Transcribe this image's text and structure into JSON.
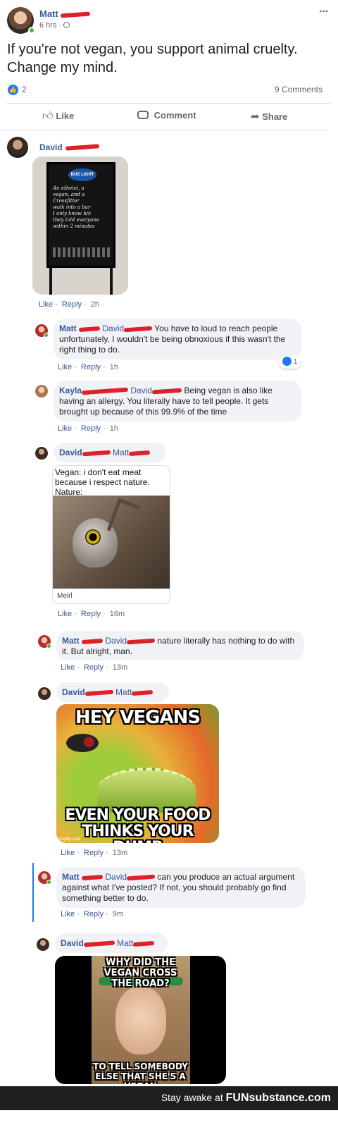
{
  "post": {
    "author": "Matt",
    "time": "6 hrs",
    "sep": "·",
    "text": "If you're not vegan, you support animal cruelty. Change my mind.",
    "like_count": "2",
    "comments_count": "9 Comments",
    "more": "···",
    "like_label": "Like",
    "comment_label": "Comment",
    "share_label": "Share"
  },
  "comments": [
    {
      "author": "David",
      "sign_lines": [
        "An atheist, a",
        "vegan, and a",
        "Crossfitter",
        "walk into a bar",
        "I only know b/c",
        "they told everyone",
        "within 2 minutes"
      ],
      "sign_logo": "BUD LIGHT",
      "actions": {
        "like": "Like",
        "reply": "Reply",
        "time": "2h"
      }
    },
    {
      "author": "Matt",
      "mention": "David",
      "text": "You have to loud to reach people unfortunately. I wouldn't be being obnoxious if this wasn't the right thing to do.",
      "reaction_count": "1",
      "actions": {
        "like": "Like",
        "reply": "Reply",
        "time": "1h"
      }
    },
    {
      "author": "Kayla",
      "mention": "David",
      "text": "Being vegan is also like having an allergy. You literally have to tell people. It gets brought up because of this 99.9% of the time",
      "actions": {
        "like": "Like",
        "reply": "Reply",
        "time": "1h"
      }
    },
    {
      "author": "David",
      "mention": "Matt",
      "card_text": "Vegan: i don't eat meat because i respect nature. Nature:",
      "card_caption": "Meirl",
      "actions": {
        "like": "Like",
        "reply": "Reply",
        "time": "16m"
      }
    },
    {
      "author": "Matt",
      "mention": "David",
      "text": "nature literally has nothing to do with it. But alright, man.",
      "actions": {
        "like": "Like",
        "reply": "Reply",
        "time": "13m"
      }
    },
    {
      "author": "David",
      "mention": "Matt",
      "meme_top": "HEY VEGANS",
      "meme_bottom": "EVEN YOUR FOOD THINKS YOUR DUMB",
      "watermark": "imgflip.com",
      "actions": {
        "like": "Like",
        "reply": "Reply",
        "time": "13m"
      }
    },
    {
      "author": "Matt",
      "mention": "David",
      "text": "can you produce an actual argument against what I've posted? If not, you should probably go find something better to do.",
      "actions": {
        "like": "Like",
        "reply": "Reply",
        "time": "9m"
      }
    },
    {
      "author": "David",
      "mention": "Matt",
      "meme_top": "WHY DID THE VEGAN CROSS THE ROAD?",
      "meme_bottom": "TO TELL SOMEBODY ELSE THAT SHE'S A VEGAN"
    }
  ],
  "footer": {
    "text": "Stay awake at",
    "brand": "FUNsubstance.com"
  },
  "colors": {
    "link": "#385898",
    "redaction": "#e0212a",
    "bubble": "#f0f2f5",
    "online": "#42b72a"
  }
}
